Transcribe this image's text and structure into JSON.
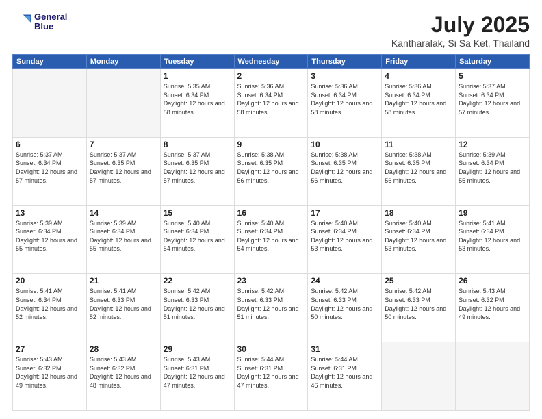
{
  "header": {
    "logo_line1": "General",
    "logo_line2": "Blue",
    "title": "July 2025",
    "subtitle": "Kantharalak, Si Sa Ket, Thailand"
  },
  "weekdays": [
    "Sunday",
    "Monday",
    "Tuesday",
    "Wednesday",
    "Thursday",
    "Friday",
    "Saturday"
  ],
  "weeks": [
    [
      {
        "day": "",
        "empty": true
      },
      {
        "day": "",
        "empty": true
      },
      {
        "day": "1",
        "sunrise": "5:35 AM",
        "sunset": "6:34 PM",
        "daylight": "12 hours and 58 minutes."
      },
      {
        "day": "2",
        "sunrise": "5:36 AM",
        "sunset": "6:34 PM",
        "daylight": "12 hours and 58 minutes."
      },
      {
        "day": "3",
        "sunrise": "5:36 AM",
        "sunset": "6:34 PM",
        "daylight": "12 hours and 58 minutes."
      },
      {
        "day": "4",
        "sunrise": "5:36 AM",
        "sunset": "6:34 PM",
        "daylight": "12 hours and 58 minutes."
      },
      {
        "day": "5",
        "sunrise": "5:37 AM",
        "sunset": "6:34 PM",
        "daylight": "12 hours and 57 minutes."
      }
    ],
    [
      {
        "day": "6",
        "sunrise": "5:37 AM",
        "sunset": "6:34 PM",
        "daylight": "12 hours and 57 minutes."
      },
      {
        "day": "7",
        "sunrise": "5:37 AM",
        "sunset": "6:35 PM",
        "daylight": "12 hours and 57 minutes."
      },
      {
        "day": "8",
        "sunrise": "5:37 AM",
        "sunset": "6:35 PM",
        "daylight": "12 hours and 57 minutes."
      },
      {
        "day": "9",
        "sunrise": "5:38 AM",
        "sunset": "6:35 PM",
        "daylight": "12 hours and 56 minutes."
      },
      {
        "day": "10",
        "sunrise": "5:38 AM",
        "sunset": "6:35 PM",
        "daylight": "12 hours and 56 minutes."
      },
      {
        "day": "11",
        "sunrise": "5:38 AM",
        "sunset": "6:35 PM",
        "daylight": "12 hours and 56 minutes."
      },
      {
        "day": "12",
        "sunrise": "5:39 AM",
        "sunset": "6:34 PM",
        "daylight": "12 hours and 55 minutes."
      }
    ],
    [
      {
        "day": "13",
        "sunrise": "5:39 AM",
        "sunset": "6:34 PM",
        "daylight": "12 hours and 55 minutes."
      },
      {
        "day": "14",
        "sunrise": "5:39 AM",
        "sunset": "6:34 PM",
        "daylight": "12 hours and 55 minutes."
      },
      {
        "day": "15",
        "sunrise": "5:40 AM",
        "sunset": "6:34 PM",
        "daylight": "12 hours and 54 minutes."
      },
      {
        "day": "16",
        "sunrise": "5:40 AM",
        "sunset": "6:34 PM",
        "daylight": "12 hours and 54 minutes."
      },
      {
        "day": "17",
        "sunrise": "5:40 AM",
        "sunset": "6:34 PM",
        "daylight": "12 hours and 53 minutes."
      },
      {
        "day": "18",
        "sunrise": "5:40 AM",
        "sunset": "6:34 PM",
        "daylight": "12 hours and 53 minutes."
      },
      {
        "day": "19",
        "sunrise": "5:41 AM",
        "sunset": "6:34 PM",
        "daylight": "12 hours and 53 minutes."
      }
    ],
    [
      {
        "day": "20",
        "sunrise": "5:41 AM",
        "sunset": "6:34 PM",
        "daylight": "12 hours and 52 minutes."
      },
      {
        "day": "21",
        "sunrise": "5:41 AM",
        "sunset": "6:33 PM",
        "daylight": "12 hours and 52 minutes."
      },
      {
        "day": "22",
        "sunrise": "5:42 AM",
        "sunset": "6:33 PM",
        "daylight": "12 hours and 51 minutes."
      },
      {
        "day": "23",
        "sunrise": "5:42 AM",
        "sunset": "6:33 PM",
        "daylight": "12 hours and 51 minutes."
      },
      {
        "day": "24",
        "sunrise": "5:42 AM",
        "sunset": "6:33 PM",
        "daylight": "12 hours and 50 minutes."
      },
      {
        "day": "25",
        "sunrise": "5:42 AM",
        "sunset": "6:33 PM",
        "daylight": "12 hours and 50 minutes."
      },
      {
        "day": "26",
        "sunrise": "5:43 AM",
        "sunset": "6:32 PM",
        "daylight": "12 hours and 49 minutes."
      }
    ],
    [
      {
        "day": "27",
        "sunrise": "5:43 AM",
        "sunset": "6:32 PM",
        "daylight": "12 hours and 49 minutes."
      },
      {
        "day": "28",
        "sunrise": "5:43 AM",
        "sunset": "6:32 PM",
        "daylight": "12 hours and 48 minutes."
      },
      {
        "day": "29",
        "sunrise": "5:43 AM",
        "sunset": "6:31 PM",
        "daylight": "12 hours and 47 minutes."
      },
      {
        "day": "30",
        "sunrise": "5:44 AM",
        "sunset": "6:31 PM",
        "daylight": "12 hours and 47 minutes."
      },
      {
        "day": "31",
        "sunrise": "5:44 AM",
        "sunset": "6:31 PM",
        "daylight": "12 hours and 46 minutes."
      },
      {
        "day": "",
        "empty": true
      },
      {
        "day": "",
        "empty": true
      }
    ]
  ]
}
